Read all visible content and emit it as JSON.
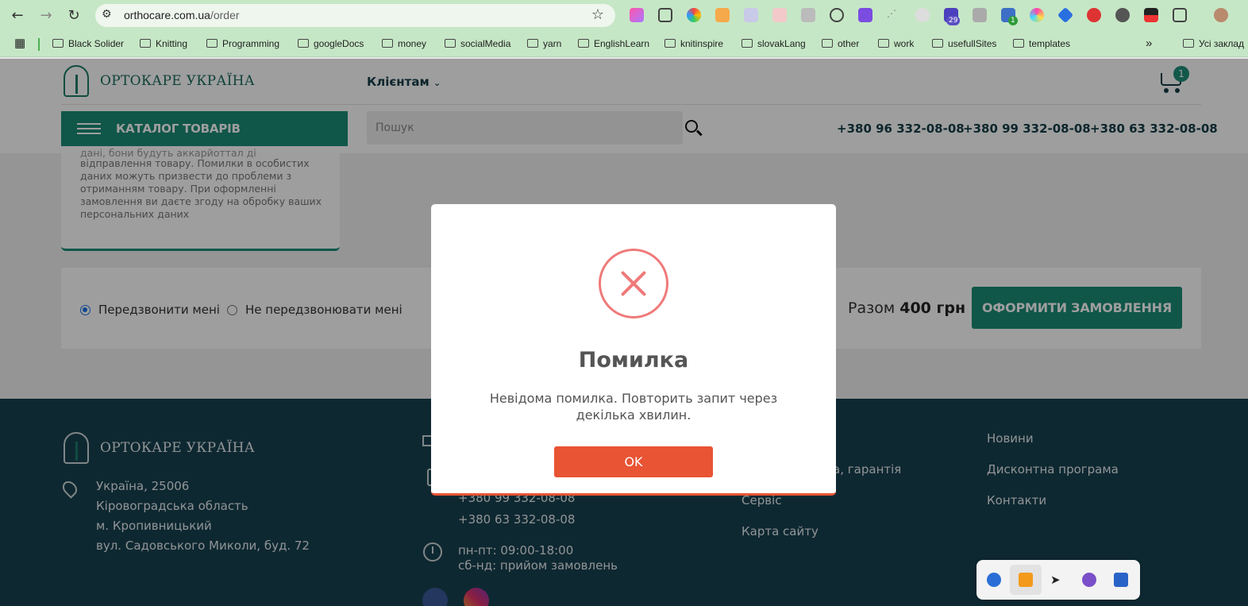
{
  "browser": {
    "url_host": "orthocare.com.ua",
    "url_path": "/order",
    "extension_badges": [
      "29",
      "1"
    ],
    "bookmarks": [
      "Black Solider",
      "Knitting",
      "Programming",
      "googleDocs",
      "money",
      "socialMedia",
      "yarn",
      "EnglishLearn",
      "knitinspire",
      "slovakLang",
      "other",
      "work",
      "usefullSites",
      "templates"
    ],
    "bookmarks_more": "»",
    "all_bookmarks": "Усі заклад"
  },
  "header": {
    "logo_text": "ОРТОКАРЕ УКРАЇНА",
    "clients_menu": "Клієнтам",
    "cart_count": "1",
    "catalog_label": "КАТАЛОГ ТОВАРІВ",
    "search_placeholder": "Пошук",
    "phones": [
      "+380 96 332-08-08",
      "+380 99 332-08-08",
      "+380 63 332-08-08"
    ]
  },
  "info_card": {
    "text_faded": "дані, бони будуть аккарйоттал ді",
    "text": "відправлення товару. Помилки в особистих даних можуть призвести до проблеми з отриманням товару. При оформленні замовлення ви даєте згоду на обробку ваших персональних даних"
  },
  "order": {
    "radio_call": "Передзвонити мені",
    "radio_nocall": "Не передзвонювати мені",
    "total_label": "Разом",
    "total_value": "400 грн",
    "submit_label": "ОФОРМИТИ ЗАМОВЛЕННЯ"
  },
  "footer": {
    "logo_text": "ОРТОКАРЕ УКРАЇНА",
    "address": [
      "Україна, 25006",
      "Кіровоградська область",
      "м. Кропивницький",
      "вул. Садовського Миколи, буд. 72"
    ],
    "phones": [
      "+380 99 332-08-08",
      "+380 63 332-08-08"
    ],
    "hours": [
      "пн-пт: 09:00-18:00",
      "сб-нд: прийом замовлень"
    ],
    "col3": [
      "ка, гарантія",
      "Сервіс",
      "Карта сайту"
    ],
    "col4": [
      "Новини",
      "Дисконтна програма",
      "Контакти"
    ]
  },
  "modal": {
    "title": "Помилка",
    "text": "Невідома помилка. Повторить запит через декілька хвилин.",
    "ok_label": "OK"
  }
}
